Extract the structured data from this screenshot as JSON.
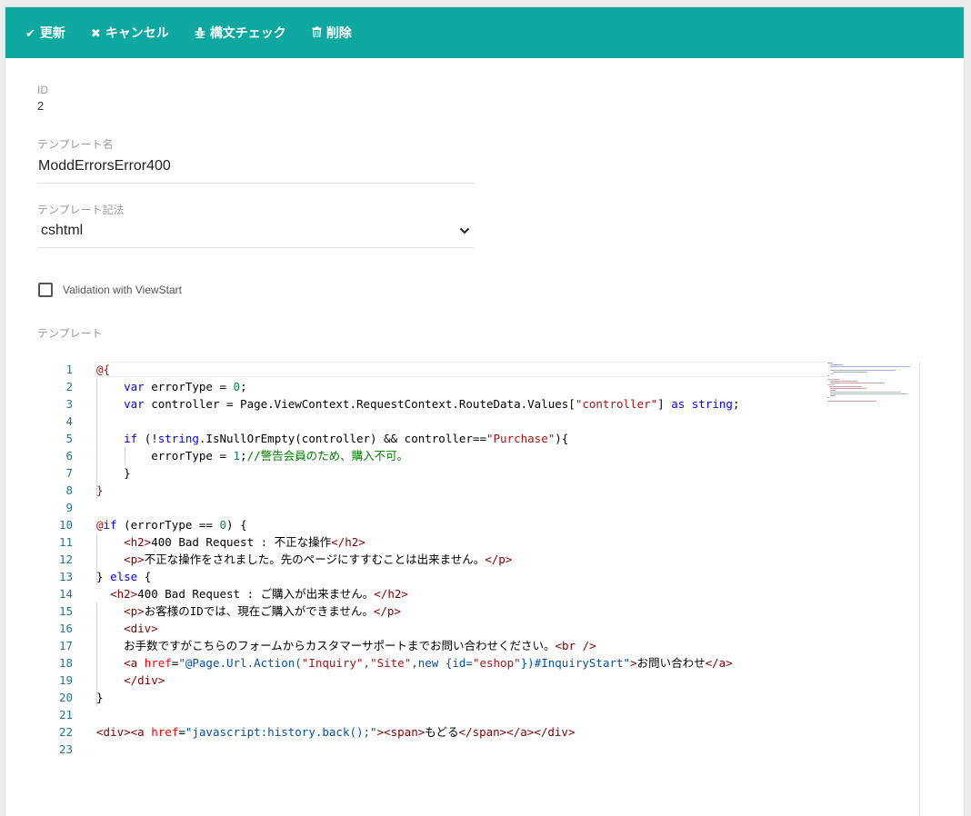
{
  "toolbar": {
    "update": "更新",
    "cancel": "キャンセル",
    "syntax_check": "構文チェック",
    "delete": "削除"
  },
  "form": {
    "id_label": "ID",
    "id_value": "2",
    "name_label": "テンプレート名",
    "name_value": "ModdErrorsError400",
    "syntax_label": "テンプレート記法",
    "syntax_value": "cshtml",
    "validation_label": "Validation with ViewStart",
    "template_label": "テンプレート"
  },
  "icons": {
    "update": "check-icon",
    "cancel": "close-icon",
    "syntax_check": "bug-icon",
    "delete": "trash-icon"
  },
  "colors": {
    "toolbar_bg": "#0ea8a0",
    "line_number": "#237893",
    "keyword": "#0000ff",
    "tag": "#800000",
    "attribute": "#ff0000",
    "string": "#a31515",
    "attribute_value": "#0451a5",
    "number": "#098658",
    "comment": "#008000"
  },
  "code_lines": [
    [
      [
        "t-razor",
        "@{"
      ]
    ],
    [
      [
        "t-norm",
        "    "
      ],
      [
        "t-kw",
        "var"
      ],
      [
        "t-norm",
        " errorType = "
      ],
      [
        "t-num",
        "0"
      ],
      [
        "t-norm",
        ";"
      ]
    ],
    [
      [
        "t-norm",
        "    "
      ],
      [
        "t-kw",
        "var"
      ],
      [
        "t-norm",
        " controller = Page.ViewContext.RequestContext.RouteData.Values["
      ],
      [
        "t-str",
        "\"controller\""
      ],
      [
        "t-norm",
        "] "
      ],
      [
        "t-kw",
        "as"
      ],
      [
        "t-norm",
        " "
      ],
      [
        "t-kw",
        "string"
      ],
      [
        "t-norm",
        ";"
      ]
    ],
    [],
    [
      [
        "t-norm",
        "    "
      ],
      [
        "t-kw",
        "if"
      ],
      [
        "t-norm",
        " (!"
      ],
      [
        "t-kw",
        "string"
      ],
      [
        "t-norm",
        ".IsNullOrEmpty(controller) && controller=="
      ],
      [
        "t-str",
        "\"Purchase\""
      ],
      [
        "t-norm",
        "){"
      ]
    ],
    [
      [
        "t-norm",
        "        errorType = "
      ],
      [
        "t-num",
        "1"
      ],
      [
        "t-norm",
        ";"
      ],
      [
        "t-com",
        "//警告会員のため、購入不可。"
      ]
    ],
    [
      [
        "t-norm",
        "    }"
      ]
    ],
    [
      [
        "t-razor",
        "}"
      ]
    ],
    [],
    [
      [
        "t-razor",
        "@"
      ],
      [
        "t-kw",
        "if"
      ],
      [
        "t-norm",
        " (errorType == "
      ],
      [
        "t-num",
        "0"
      ],
      [
        "t-norm",
        ") {"
      ]
    ],
    [
      [
        "t-norm",
        "    "
      ],
      [
        "t-tag",
        "<h2>"
      ],
      [
        "t-norm",
        "400 Bad Request : 不正な操作"
      ],
      [
        "t-tag",
        "</h2>"
      ]
    ],
    [
      [
        "t-norm",
        "    "
      ],
      [
        "t-tag",
        "<p>"
      ],
      [
        "t-norm",
        "不正な操作をされました。先のページにすすむことは出来ません。"
      ],
      [
        "t-tag",
        "</p>"
      ]
    ],
    [
      [
        "t-norm",
        "} "
      ],
      [
        "t-kw",
        "else"
      ],
      [
        "t-norm",
        " {"
      ]
    ],
    [
      [
        "t-norm",
        "  "
      ],
      [
        "t-tag",
        "<h2>"
      ],
      [
        "t-norm",
        "400 Bad Request : ご購入が出来ません。"
      ],
      [
        "t-tag",
        "</h2>"
      ]
    ],
    [
      [
        "t-norm",
        "    "
      ],
      [
        "t-tag",
        "<p>"
      ],
      [
        "t-norm",
        "お客様のIDでは、現在ご購入ができません。"
      ],
      [
        "t-tag",
        "</p>"
      ]
    ],
    [
      [
        "t-norm",
        "    "
      ],
      [
        "t-tag",
        "<div>"
      ]
    ],
    [
      [
        "t-norm",
        "    お手数ですがこちらのフォームからカスタマーサポートまでお問い合わせください。"
      ],
      [
        "t-tag",
        "<br />"
      ]
    ],
    [
      [
        "t-norm",
        "    "
      ],
      [
        "t-tag",
        "<a "
      ],
      [
        "t-attr",
        "href"
      ],
      [
        "t-norm",
        "="
      ],
      [
        "t-aval",
        "\"@Page.Url.Action("
      ],
      [
        "t-str",
        "\"Inquiry\""
      ],
      [
        "t-aval",
        ","
      ],
      [
        "t-str",
        "\"Site\""
      ],
      [
        "t-aval",
        ",new {id="
      ],
      [
        "t-str",
        "\"eshop\""
      ],
      [
        "t-aval",
        "})#InquiryStart\""
      ],
      [
        "t-tag",
        ">"
      ],
      [
        "t-norm",
        "お問い合わせ"
      ],
      [
        "t-tag",
        "</a>"
      ]
    ],
    [
      [
        "t-norm",
        "    "
      ],
      [
        "t-tag",
        "</div>"
      ]
    ],
    [
      [
        "t-norm",
        "}"
      ]
    ],
    [],
    [
      [
        "t-tag",
        "<div><a "
      ],
      [
        "t-attr",
        "href"
      ],
      [
        "t-norm",
        "="
      ],
      [
        "t-aval",
        "\"javascript:history.back();\""
      ],
      [
        "t-tag",
        "><span>"
      ],
      [
        "t-norm",
        "もどる"
      ],
      [
        "t-tag",
        "</span></a></div>"
      ]
    ],
    []
  ]
}
